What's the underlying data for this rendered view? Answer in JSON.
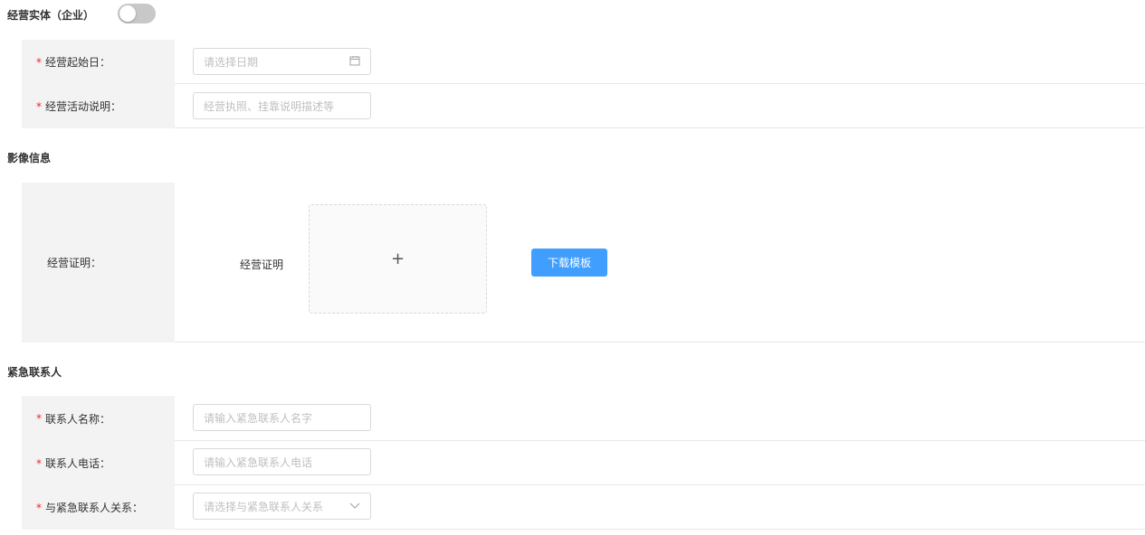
{
  "business": {
    "title": "经营实体（企业）",
    "toggle_on": false,
    "fields": [
      {
        "label": "经营起始日：",
        "required": true,
        "placeholder": "请选择日期",
        "icon": "calendar-icon"
      },
      {
        "label": "经营活动说明：",
        "required": true,
        "placeholder": "经营执照、挂靠说明描述等"
      }
    ]
  },
  "images": {
    "title": "影像信息",
    "label": "经营证明：",
    "upload_caption": "经营证明",
    "upload_plus": "+",
    "download_label": "下载模板"
  },
  "contact": {
    "title": "紧急联系人",
    "fields": [
      {
        "label": "联系人名称：",
        "required": true,
        "placeholder": "请输入紧急联系人名字"
      },
      {
        "label": "联系人电话：",
        "required": true,
        "placeholder": "请输入紧急联系人电话"
      },
      {
        "label": "与紧急联系人关系：",
        "required": true,
        "placeholder": "请选择与紧急联系人关系",
        "icon": "chevron-down-icon"
      }
    ]
  },
  "required_mark": "*",
  "icons": {
    "calendar": "🗓",
    "chevron": "∨"
  }
}
